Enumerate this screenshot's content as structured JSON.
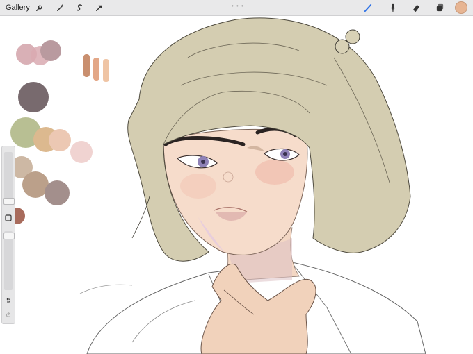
{
  "toolbar": {
    "gallery_label": "Gallery",
    "left_tools": [
      {
        "name": "actions-wrench-icon"
      },
      {
        "name": "adjustments-magic-wand-icon"
      },
      {
        "name": "selection-icon"
      },
      {
        "name": "transform-arrow-icon"
      }
    ],
    "right_tools": [
      {
        "name": "brush-icon"
      },
      {
        "name": "smudge-icon"
      },
      {
        "name": "eraser-icon"
      },
      {
        "name": "layers-icon"
      }
    ],
    "active_color": "#e7b593"
  },
  "sidebar": {
    "brush_size_level": 0.3,
    "opacity_level": 0.15,
    "buttons": [
      "modifier-square-icon",
      "undo-icon",
      "redo-icon"
    ]
  },
  "palette_colors": [
    "#d5a7ae",
    "#b99a9f",
    "#786a6e",
    "#b8bf93",
    "#dcb98f",
    "#ecc8b3",
    "#bba08a",
    "#a38f8c",
    "#a86b5c",
    "#c98f6f",
    "#e3a787",
    "#efc4a4"
  ]
}
